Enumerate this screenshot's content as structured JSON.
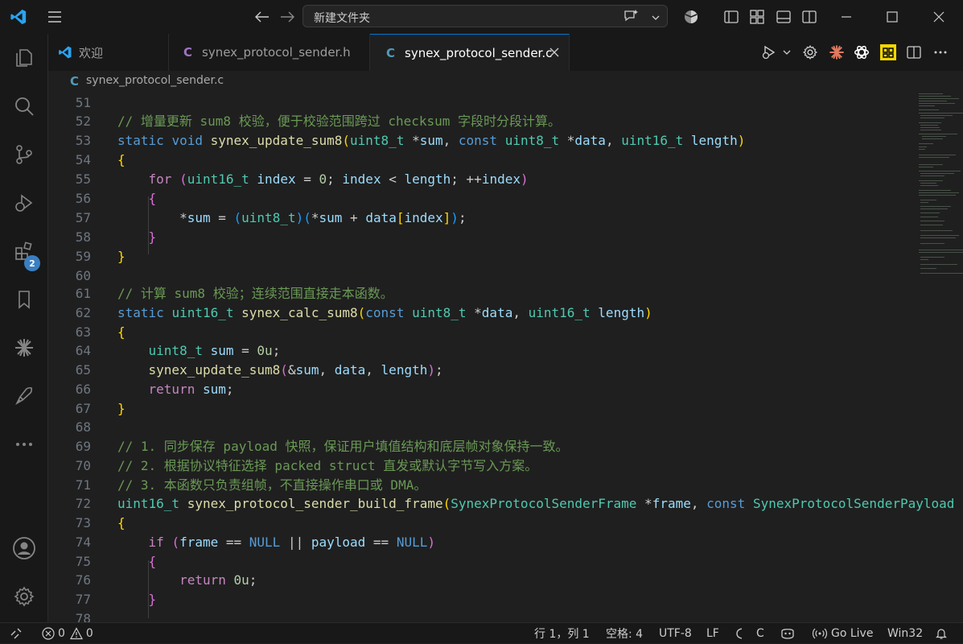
{
  "titlebar": {
    "search_text": "新建文件夹",
    "icons": [
      "vscode-logo",
      "menu-icon",
      "back-arrow-icon",
      "forward-arrow-icon",
      "copilot-icon",
      "chevron-down-icon",
      "accounts-icon",
      "toggle-sidebar-icon",
      "layout-icon",
      "toggle-panel-icon",
      "toggle-secondary-sidebar-icon",
      "minimize-icon",
      "maximize-icon",
      "close-icon"
    ]
  },
  "activity_bar": {
    "items": [
      "explorer-icon",
      "search-icon",
      "source-control-icon",
      "run-debug-icon",
      "extensions-icon",
      "bookmarks-icon",
      "ai-assistant-icon",
      "deploy-icon",
      "more-icon"
    ],
    "extensions_badge": "2",
    "bottom": [
      "account-icon",
      "settings-icon"
    ]
  },
  "tabs": [
    {
      "label": "欢迎",
      "icon": "vscode",
      "active": false
    },
    {
      "label": "synex_protocol_sender.h",
      "icon": "C",
      "active": false
    },
    {
      "label": "synex_protocol_sender.c",
      "icon": "C",
      "active": true
    }
  ],
  "breadcrumb": {
    "icon": "C",
    "file": "synex_protocol_sender.c"
  },
  "editor": {
    "line_numbers": [
      "51",
      "52",
      "53",
      "54",
      "55",
      "56",
      "57",
      "58",
      "59",
      "60",
      "61",
      "62",
      "63",
      "64",
      "65",
      "66",
      "67",
      "68",
      "69",
      "70",
      "71",
      "72",
      "73",
      "74",
      "75",
      "76",
      "77",
      "78"
    ]
  },
  "statusbar": {
    "errors": "0",
    "warnings": "0",
    "position": "行 1，列 1",
    "indent": "空格: 4",
    "encoding": "UTF-8",
    "eol": "LF",
    "language": "C",
    "golive": "Go Live",
    "platform": "Win32"
  },
  "colors": {
    "keyword": "#569cd6",
    "type": "#4ec9b0",
    "function": "#dcdcaa",
    "variable": "#9cdcfe",
    "comment": "#6a9955",
    "number": "#b5cea8",
    "accent": "#0078d4"
  }
}
